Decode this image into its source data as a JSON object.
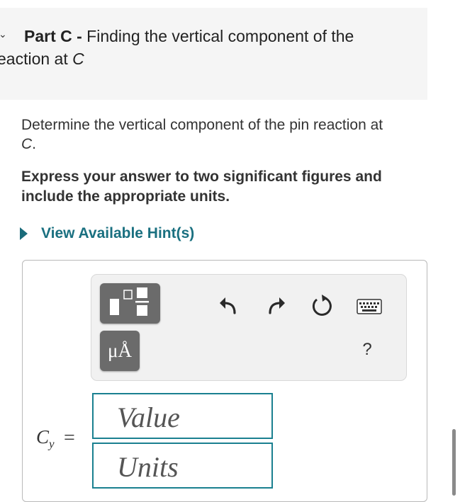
{
  "header": {
    "part_label": "Part C -",
    "title_line1": " Finding the vertical component of the",
    "title_line2_prefix": "eaction at ",
    "title_line2_var": "C"
  },
  "question": {
    "text": "Determine the vertical component of the pin reaction at",
    "var": "C",
    "suffix": "."
  },
  "instructions": "Express your answer to two significant figures and include the appropriate units.",
  "hint": {
    "label": "View Available Hint(s)"
  },
  "toolbar": {
    "units_label": "μÅ",
    "help_label": "?",
    "icons": [
      "templates-icon",
      "units-icon",
      "undo-icon",
      "redo-icon",
      "reset-icon",
      "keyboard-icon",
      "help-icon"
    ]
  },
  "answer": {
    "variable": "C",
    "subscript": "y",
    "equals": "=",
    "value_placeholder": "Value",
    "units_placeholder": "Units"
  },
  "colors": {
    "accent": "#1a8090",
    "hint_text": "#1a7080",
    "button_bg": "#6b6b6b",
    "header_bg": "#f5f5f5"
  }
}
